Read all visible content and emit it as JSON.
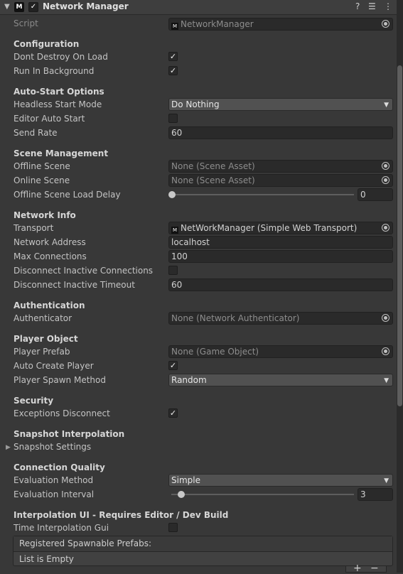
{
  "header": {
    "title": "Network Manager",
    "logo_text": "M",
    "enabled_mark": "✓"
  },
  "script": {
    "label": "Script",
    "value": "NetworkManager"
  },
  "configuration": {
    "section": "Configuration",
    "dont_destroy": {
      "label": "Dont Destroy On Load",
      "checked": "✓"
    },
    "run_bg": {
      "label": "Run In Background",
      "checked": "✓"
    }
  },
  "autostart": {
    "section": "Auto-Start Options",
    "headless": {
      "label": "Headless Start Mode",
      "value": "Do Nothing"
    },
    "editor_auto": {
      "label": "Editor Auto Start",
      "checked": ""
    },
    "send_rate": {
      "label": "Send Rate",
      "value": "60"
    }
  },
  "scene": {
    "section": "Scene Management",
    "offline": {
      "label": "Offline Scene",
      "value": "None (Scene Asset)"
    },
    "online": {
      "label": "Online Scene",
      "value": "None (Scene Asset)"
    },
    "delay": {
      "label": "Offline Scene Load Delay",
      "value": "0",
      "fraction": 0
    }
  },
  "netinfo": {
    "section": "Network Info",
    "transport": {
      "label": "Transport",
      "value": "NetWorkManager (Simple Web Transport)"
    },
    "address": {
      "label": "Network Address",
      "value": "localhost"
    },
    "maxconn": {
      "label": "Max Connections",
      "value": "100"
    },
    "disc_inactive": {
      "label": "Disconnect Inactive Connections",
      "checked": ""
    },
    "disc_timeout": {
      "label": "Disconnect Inactive Timeout",
      "value": "60"
    }
  },
  "auth": {
    "section": "Authentication",
    "authenticator": {
      "label": "Authenticator",
      "value": "None (Network Authenticator)"
    }
  },
  "player": {
    "section": "Player Object",
    "prefab": {
      "label": "Player Prefab",
      "value": "None (Game Object)"
    },
    "auto_create": {
      "label": "Auto Create Player",
      "checked": "✓"
    },
    "spawn_method": {
      "label": "Player Spawn Method",
      "value": "Random"
    }
  },
  "security": {
    "section": "Security",
    "exceptions": {
      "label": "Exceptions Disconnect",
      "checked": "✓"
    }
  },
  "snapshot": {
    "section": "Snapshot Interpolation",
    "settings": {
      "label": "Snapshot Settings"
    }
  },
  "quality": {
    "section": "Connection Quality",
    "method": {
      "label": "Evaluation Method",
      "value": "Simple"
    },
    "interval": {
      "label": "Evaluation Interval",
      "value": "3",
      "fraction": 0.05
    }
  },
  "interp_ui": {
    "section": "Interpolation UI - Requires Editor / Dev Build",
    "gui": {
      "label": "Time Interpolation Gui",
      "checked": ""
    }
  },
  "prefabs": {
    "header": "Registered Spawnable Prefabs:",
    "empty": "List is Empty",
    "plus": "+",
    "minus": "−"
  },
  "icons": {
    "help": "help-icon",
    "settings": "sliders-icon",
    "menu": "kebab-menu-icon",
    "picker": "object-picker-icon"
  }
}
